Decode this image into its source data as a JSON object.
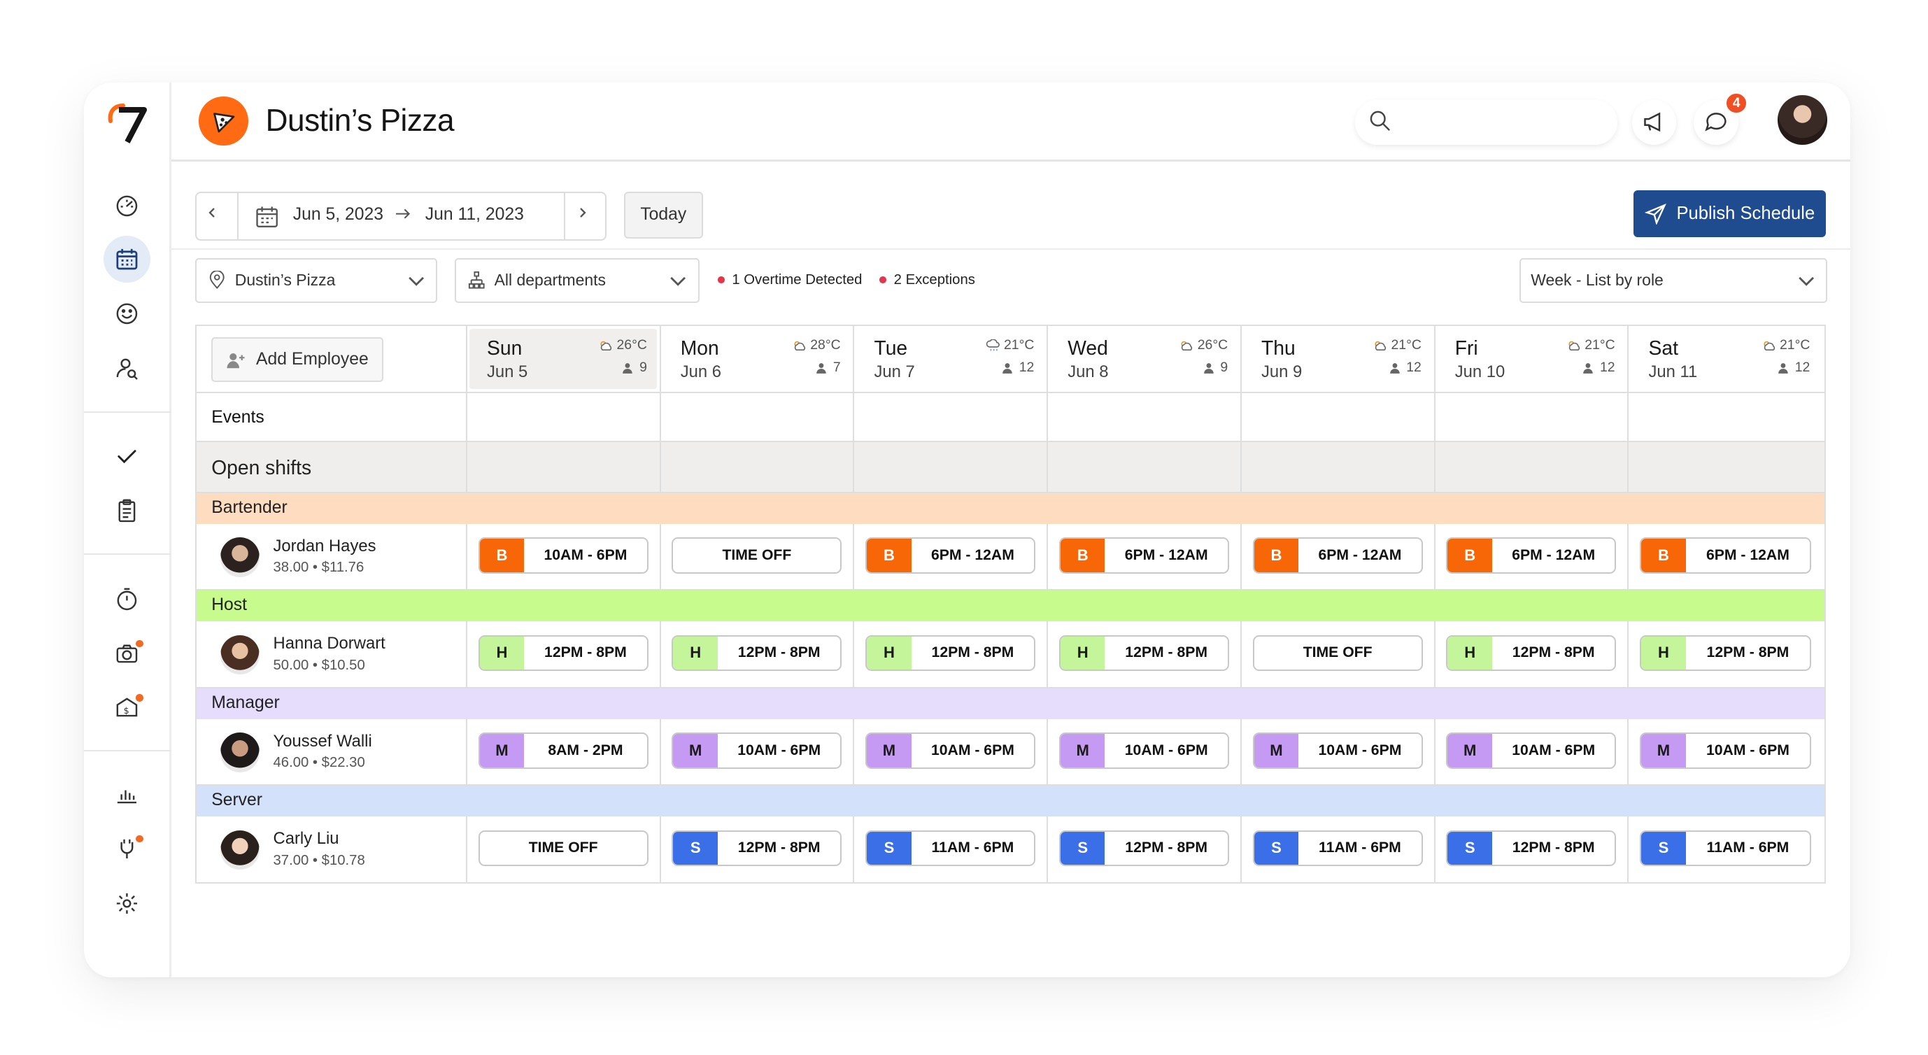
{
  "brand": {
    "title": "Dustin’s Pizza",
    "logo_mark": "7"
  },
  "header": {
    "notification_count": "4"
  },
  "date_range": {
    "start": "Jun 5, 2023",
    "end": "Jun 11, 2023",
    "today_label": "Today"
  },
  "publish_label": "Publish Schedule",
  "filters": {
    "location": "Dustin’s Pizza",
    "department": "All departments",
    "overtime_alert": "1 Overtime Detected",
    "exceptions_alert": "2 Exceptions",
    "view": "Week - List by role"
  },
  "grid": {
    "add_employee_label": "Add Employee",
    "events_label": "Events",
    "open_shifts_label": "Open shifts",
    "days": [
      {
        "name": "Sun",
        "date": "Jun 5",
        "temp": "26°C",
        "staff": "9",
        "weather": "partly-cloudy-icon",
        "selected": true
      },
      {
        "name": "Mon",
        "date": "Jun 6",
        "temp": "28°C",
        "staff": "7",
        "weather": "partly-cloudy-icon",
        "selected": false
      },
      {
        "name": "Tue",
        "date": "Jun 7",
        "temp": "21°C",
        "staff": "12",
        "weather": "rain-icon",
        "selected": false
      },
      {
        "name": "Wed",
        "date": "Jun 8",
        "temp": "26°C",
        "staff": "9",
        "weather": "partly-cloudy-icon",
        "selected": false
      },
      {
        "name": "Thu",
        "date": "Jun 9",
        "temp": "21°C",
        "staff": "12",
        "weather": "partly-cloudy-icon",
        "selected": false
      },
      {
        "name": "Fri",
        "date": "Jun 10",
        "temp": "21°C",
        "staff": "12",
        "weather": "partly-cloudy-icon",
        "selected": false
      },
      {
        "name": "Sat",
        "date": "Jun 11",
        "temp": "21°C",
        "staff": "12",
        "weather": "partly-cloudy-icon",
        "selected": false
      }
    ],
    "roles": [
      {
        "name": "Bartender",
        "band_color": "#fedcc0",
        "tag_color": "#f76707",
        "tag_text_color": "#ffffff",
        "employee": {
          "name": "Jordan Hayes",
          "meta": "38.00 • $11.76"
        },
        "shifts": [
          {
            "tag": "B",
            "time": "10AM - 6PM"
          },
          {
            "tag": "",
            "time": "TIME OFF"
          },
          {
            "tag": "B",
            "time": "6PM - 12AM"
          },
          {
            "tag": "B",
            "time": "6PM - 12AM"
          },
          {
            "tag": "B",
            "time": "6PM - 12AM"
          },
          {
            "tag": "B",
            "time": "6PM - 12AM"
          },
          {
            "tag": "B",
            "time": "6PM - 12AM"
          }
        ]
      },
      {
        "name": "Host",
        "band_color": "#c7fb8d",
        "tag_color": "#c4f59a",
        "tag_text_color": "#1a1a1a",
        "employee": {
          "name": "Hanna Dorwart",
          "meta": "50.00 • $10.50"
        },
        "shifts": [
          {
            "tag": "H",
            "time": "12PM - 8PM"
          },
          {
            "tag": "H",
            "time": "12PM - 8PM"
          },
          {
            "tag": "H",
            "time": "12PM - 8PM"
          },
          {
            "tag": "H",
            "time": "12PM - 8PM"
          },
          {
            "tag": "",
            "time": "TIME OFF"
          },
          {
            "tag": "H",
            "time": "12PM - 8PM"
          },
          {
            "tag": "H",
            "time": "12PM - 8PM"
          }
        ]
      },
      {
        "name": "Manager",
        "band_color": "#e6dcfb",
        "tag_color": "#c49af2",
        "tag_text_color": "#1a1a1a",
        "employee": {
          "name": "Youssef Walli",
          "meta": "46.00 • $22.30"
        },
        "shifts": [
          {
            "tag": "M",
            "time": "8AM - 2PM"
          },
          {
            "tag": "M",
            "time": "10AM - 6PM"
          },
          {
            "tag": "M",
            "time": "10AM - 6PM"
          },
          {
            "tag": "M",
            "time": "10AM - 6PM"
          },
          {
            "tag": "M",
            "time": "10AM - 6PM"
          },
          {
            "tag": "M",
            "time": "10AM - 6PM"
          },
          {
            "tag": "M",
            "time": "10AM - 6PM"
          }
        ]
      },
      {
        "name": "Server",
        "band_color": "#d3e1fa",
        "tag_color": "#3a6fe8",
        "tag_text_color": "#ffffff",
        "employee": {
          "name": "Carly Liu",
          "meta": "37.00 • $10.78"
        },
        "shifts": [
          {
            "tag": "",
            "time": "TIME OFF"
          },
          {
            "tag": "S",
            "time": "12PM - 8PM"
          },
          {
            "tag": "S",
            "time": "11AM - 6PM"
          },
          {
            "tag": "S",
            "time": "12PM - 8PM"
          },
          {
            "tag": "S",
            "time": "11AM - 6PM"
          },
          {
            "tag": "S",
            "time": "12PM - 8PM"
          },
          {
            "tag": "S",
            "time": "11AM - 6PM"
          }
        ]
      }
    ]
  }
}
